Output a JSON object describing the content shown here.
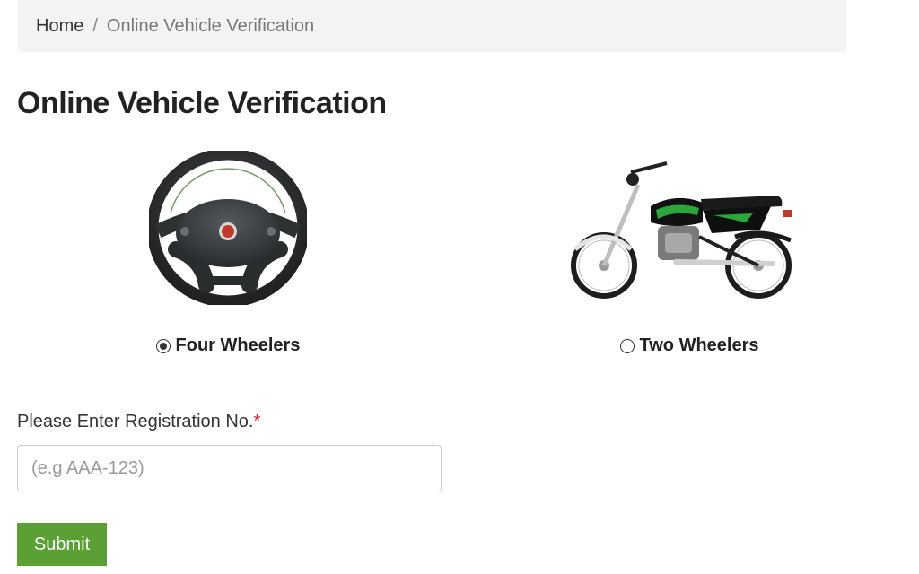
{
  "breadcrumb": {
    "home": "Home",
    "separator": "/",
    "current": "Online Vehicle Verification"
  },
  "page_title": "Online Vehicle Verification",
  "vehicle_types": {
    "four": {
      "label": "Four Wheelers",
      "selected": true,
      "icon": "steering-wheel-icon"
    },
    "two": {
      "label": "Two Wheelers",
      "selected": false,
      "icon": "motorcycle-icon"
    }
  },
  "registration": {
    "label": "Please Enter Registration No.",
    "required_mark": "*",
    "placeholder": "(e.g AAA-123)",
    "value": ""
  },
  "submit_label": "Submit",
  "colors": {
    "submit_button": "#5aa034",
    "required_mark": "#d9232d",
    "breadcrumb_bg": "#f3f3f3"
  }
}
